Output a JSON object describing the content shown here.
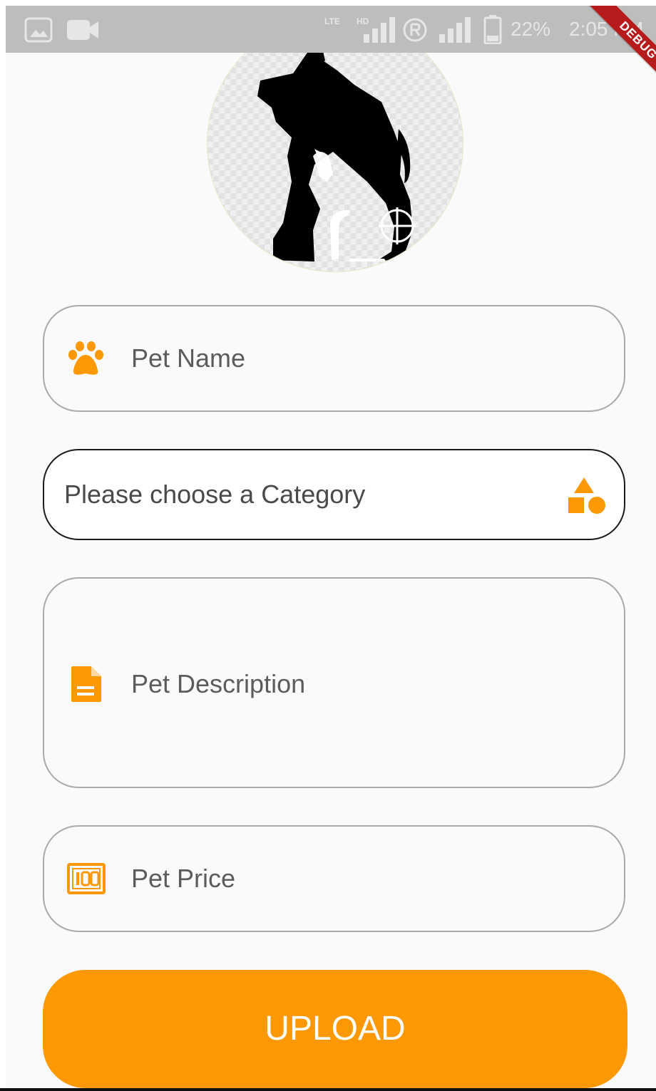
{
  "status_bar": {
    "network_top": "LTE",
    "network_hd": "HD",
    "battery": "22%",
    "time": "2:05 PM"
  },
  "debug_banner": "DEBUG",
  "form": {
    "pet_name": {
      "placeholder": "Pet Name",
      "icon": "paw-icon"
    },
    "category": {
      "placeholder": "Please choose a Category",
      "icon": "shapes-icon"
    },
    "description": {
      "placeholder": "Pet Description",
      "icon": "description-icon"
    },
    "price": {
      "placeholder": "Pet Price",
      "icon": "price-icon"
    },
    "upload_label": "UPLOAD"
  },
  "colors": {
    "accent": "#fb9804",
    "status_bar": "#bdbdbd",
    "banner": "#b71c1c"
  }
}
